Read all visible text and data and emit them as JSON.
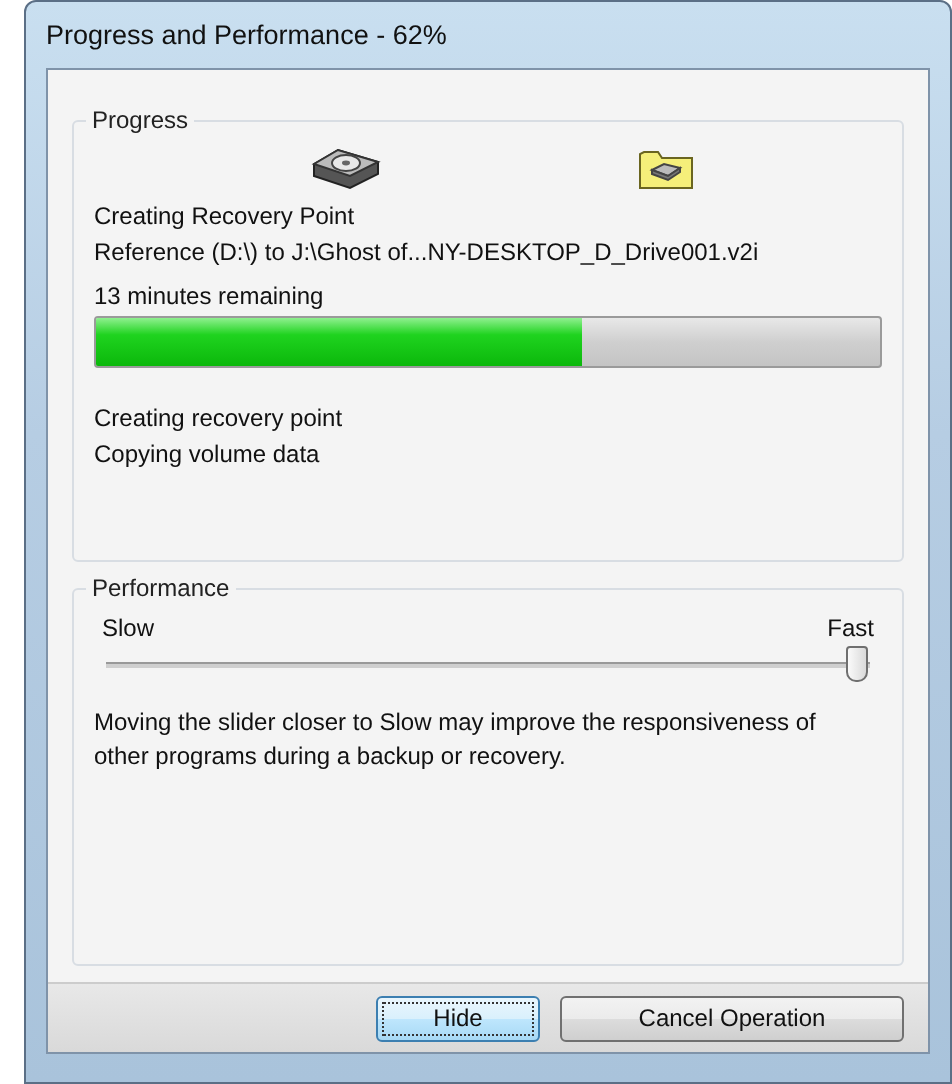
{
  "window": {
    "title": "Progress and Performance - 62%"
  },
  "progress": {
    "group_label": "Progress",
    "heading": "Creating Recovery Point",
    "path": "Reference (D:\\) to J:\\Ghost of...NY-DESKTOP_D_Drive001.v2i",
    "remaining": "13 minutes remaining",
    "level": 0.62,
    "status_lines": [
      "Creating recovery point",
      "Copying volume data"
    ]
  },
  "performance": {
    "group_label": "Performance",
    "min_label": "Slow",
    "max_label": "Fast",
    "level": 1,
    "note": "Moving the slider closer to Slow may improve the responsiveness of other programs during a backup or recovery."
  },
  "buttons": [
    {
      "label": "Hide",
      "focused": true
    },
    {
      "label": "Cancel Operation",
      "focused": false
    }
  ]
}
